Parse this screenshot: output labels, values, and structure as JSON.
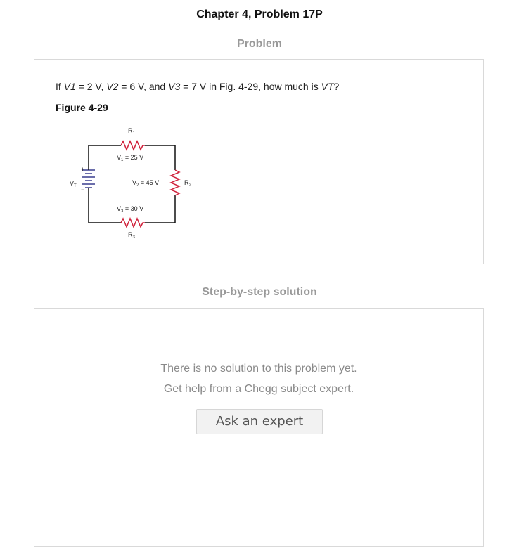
{
  "header": {
    "chapter_title": "Chapter 4, Problem 17P"
  },
  "problem": {
    "heading": "Problem",
    "text_parts": [
      "If ",
      "V1",
      " = 2 V, ",
      "V2",
      " = 6 V, and ",
      "V3",
      " = 7 V in Fig. 4-29, how much is ",
      "VT",
      "?"
    ],
    "figure_label": "Figure 4-29",
    "circuit": {
      "r1_label": "R",
      "r1_sub": "1",
      "v1_label": "V",
      "v1_sub": "1",
      "v1_value": " = 25 V",
      "r2_label": "R",
      "r2_sub": "2",
      "v2_label": "V",
      "v2_sub": "2",
      "v2_value": " = 45 V",
      "r3_label": "R",
      "r3_sub": "3",
      "v3_label": "V",
      "v3_sub": "3",
      "v3_value": " = 30 V",
      "vt_label": "V",
      "vt_sub": "T",
      "plus": "+",
      "minus": "−",
      "resistor_color": "#d0213b",
      "battery_color": "#3a3f8f"
    }
  },
  "solution": {
    "heading": "Step-by-step solution",
    "line1": "There is no solution to this problem yet.",
    "line2": "Get help from a Chegg subject expert.",
    "button_label": "Ask an expert"
  }
}
